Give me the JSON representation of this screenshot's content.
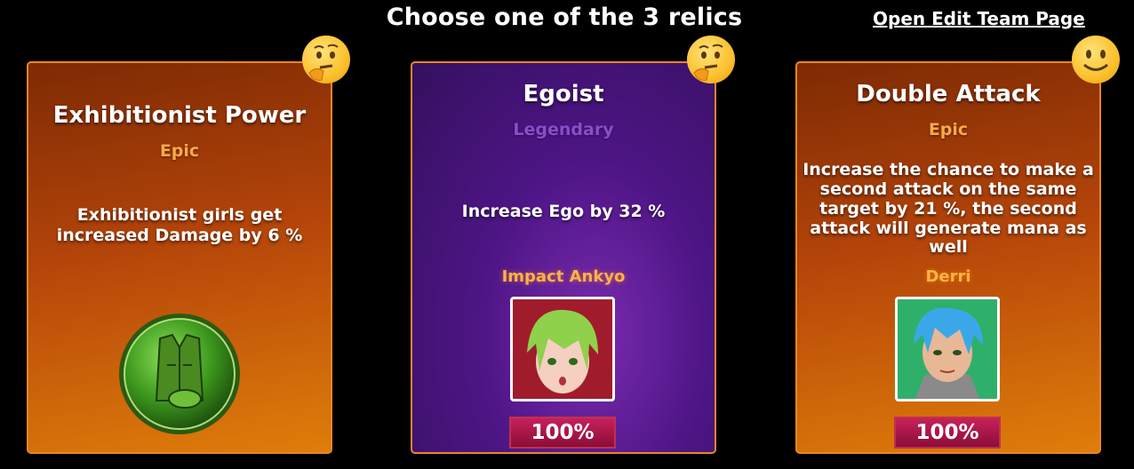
{
  "header": {
    "title": "Choose one of the 3 relics",
    "edit_team_link": "Open Edit Team Page"
  },
  "relics": [
    {
      "name": "Exhibitionist Power",
      "rarity": "Epic",
      "description": "Exhibitionist girls get increased Damage by 6 %",
      "icon": "jacket-relic-icon",
      "emoji": "thinking-face-icon"
    },
    {
      "name": "Egoist",
      "rarity": "Legendary",
      "description": "Increase Ego by 32 %",
      "girl": "Impact Ankyo",
      "percent": "100%",
      "emoji": "thinking-face-icon"
    },
    {
      "name": "Double Attack",
      "rarity": "Epic",
      "description": "Increase the chance to make a second attack on the same target by 21 %, the second attack will generate mana as well",
      "girl": "Derri",
      "percent": "100%",
      "emoji": "smiling-face-icon"
    }
  ],
  "colors": {
    "epic_bg": "#b3440a",
    "legendary_bg": "#4d1585",
    "border": "#e8852a",
    "epic_text": "#f6a94a",
    "legendary_text": "#8a4ccc",
    "percent_bg": "#c8205a"
  }
}
